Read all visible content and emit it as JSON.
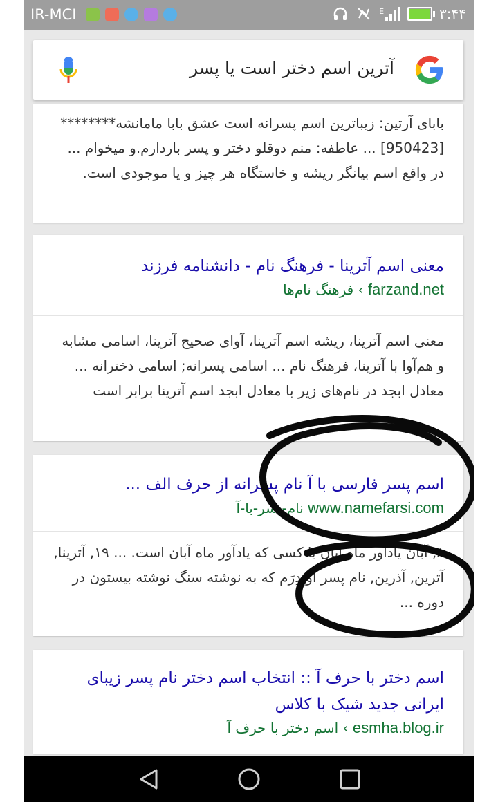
{
  "status_bar": {
    "carrier": "IR-MCI",
    "time": "۳:۴۴",
    "network_label": "E",
    "battery_level": 0.9,
    "notification_icons": [
      "headset-app-icon",
      "mail-app-icon",
      "telegram-icon",
      "gallery-icon",
      "telegram-icon"
    ]
  },
  "search": {
    "query": "آترین اسم دختر است یا پسر"
  },
  "results": [
    {
      "snippet": "بابای آرتین: زیباترین اسم پسرانه است عشق بابا مامانشه******** [950423] ... عاطفه: منم دوقلو دختر و پسر باردارم.و میخوام ... در واقع اسم بیانگر ریشه و خاستگاه هر چیز و یا موجودی است."
    },
    {
      "title": "معنی اسم آترینا - فرهنگ نام - دانشنامه فرزند",
      "domain": "farzand.net",
      "path": "فرهنگ نام‌ها",
      "snippet": "معنی اسم آترینا، ریشه اسم آترینا، آوای صحیح آترینا، اسامی مشابه و هم‌آوا با آترینا، فرهنگ نام ... اسامی پسرانه; اسامی دخترانه ... معادل ابجد در نام‌های زیر با معادل ابجد اسم آترینا برابر است"
    },
    {
      "title": "اسم پسر فارسی با آ نام پسرانه از حرف الف ...",
      "domain": "www.namefarsi.com",
      "path": "نام-پسر-با-آ",
      "snippet": "۸, آبان یادآور ماه آبان یا کسی که یادآور ماه آبان است. ... ۱۹, آترینا, آترین, آذرین, نام پسر اوپدِرَم که به نوشته سنگ نوشته بیستون در دوره ..."
    },
    {
      "title": "اسم دختر با حرف آ :: انتخاب اسم دختر نام پسر زیبای ایرانی جدید شیک با کلاس",
      "domain": "esmha.blog.ir",
      "path": "اسم دختر با حرف آ"
    }
  ],
  "colors": {
    "status_bar": "#9e9e9e",
    "link": "#1a0dab",
    "url": "#137333",
    "background": "#e8e8e8"
  },
  "nav_bar": [
    "back-icon",
    "home-icon",
    "recents-icon"
  ]
}
